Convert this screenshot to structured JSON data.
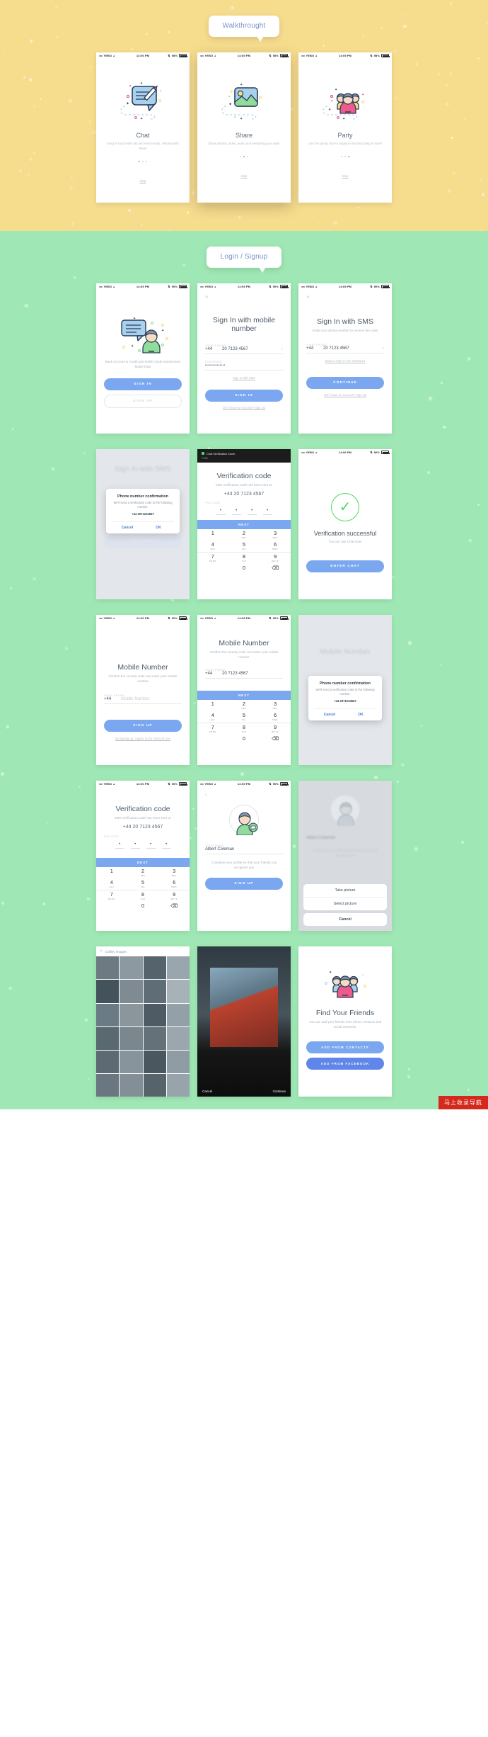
{
  "sections": {
    "walkthrough": {
      "pill_label": "Walkthrought",
      "bg": "#f6dc8d",
      "cards": [
        {
          "title": "Chat",
          "desc": "Keep in touch with old and new friends, chitchat with them!",
          "skip": "Skip",
          "icon": "chat-bubble-pencil-icon"
        },
        {
          "title": "Share",
          "desc": "Share photos, video, audio and everything you want",
          "skip": "Skip",
          "icon": "photo-landscape-icon"
        },
        {
          "title": "Party",
          "desc": "Use the gorup chat to organize the best party in town!",
          "skip": "Skip",
          "icon": "people-group-icon"
        }
      ]
    },
    "login": {
      "pill_label": "Login / Signup",
      "bg": "#9fe8b5"
    }
  },
  "status_bar": {
    "carrier": "YEBO",
    "dots": "•••••",
    "time": "14:05 PM",
    "time_alt": "14:06 PM",
    "battery": "98%",
    "battery_alt": "90%"
  },
  "screens": {
    "welcome": {
      "caption": "Bank Account & Credit and Debit Cards transactions Made Easy",
      "sign_in": "SIGN IN",
      "sign_up": "SIGN UP"
    },
    "sign_in_mobile": {
      "close": "×",
      "title": "Sign In with mobile number",
      "phone_label": "YOUR PHONE",
      "country_code": "+44",
      "phone_value": "20 7123 4567",
      "clear": "×",
      "password_label": "PASSWORD",
      "password_value": "••••••••••••••",
      "sms_link": "Sign In with SMS",
      "button": "SIGN IN",
      "footer": "Don't have an account? Sign Up"
    },
    "sign_in_sms": {
      "close": "×",
      "title": "Sign In with SMS",
      "subtitle": "Enter your phone number to receive the code",
      "phone_label": "YOUR PHONE",
      "country_code": "+44",
      "phone_value": "20 7123 4567",
      "clear": "×",
      "back_link": "Back to Sign In with Password",
      "button": "CONTINUE",
      "footer": "Don't have an account? Sign Up"
    },
    "sms_confirm": {
      "title": "Sign In with SMS",
      "modal_title": "Phone number confirmation",
      "modal_text": "We'll send a verification code to the following number:",
      "modal_number": "+44 2071234567",
      "cancel": "Cancel",
      "ok": "OK",
      "button": "CONTINUE"
    },
    "verification_code": {
      "chat_title": "Chat Verification Code:",
      "chat_code": "7162",
      "title": "Verification code",
      "subtitle": "SMS verification code has been sent to:",
      "number": "+44 20 7123 4567",
      "pin_label": "PIN CODE",
      "next": "NEXT"
    },
    "verification_success": {
      "icon": "check-circle-icon",
      "title": "Verification successful",
      "subtitle": "You can use Chat now!",
      "button": "ENTER CHAT"
    },
    "mobile_number_signup": {
      "title": "Mobile Number",
      "subtitle": "Confirm the country code and enter your mobile number",
      "phone_label": "YOUR PHONE",
      "country_code": "+44",
      "placeholder": "Mobile Number",
      "button": "SIGN UP",
      "footer": "By signing up, I agree to the Terms of Use"
    },
    "mobile_number_filled": {
      "title": "Mobile Number",
      "subtitle": "Confirm the country code and enter your mobile number",
      "phone_label": "YOUR PHONE",
      "country_code": "+44",
      "phone_value": "20 7123 4567",
      "next": "NEXT"
    },
    "mobile_number_modal": {
      "title": "Mobile Number",
      "modal_title": "Phone number confirmation",
      "modal_text": "We'll send a verification code to the following number:",
      "modal_number": "+44 2071234567",
      "cancel": "Cancel",
      "ok": "OK",
      "button": "SIGN UP"
    },
    "verification_keypad": {
      "title": "Verification code",
      "subtitle": "SMS verification code has been sent to:",
      "number": "+44 20 7123 4567",
      "pin_label": "PIN CODE",
      "next": "NEXT"
    },
    "profile_name": {
      "back": "‹",
      "name_label": "YOUR NAME",
      "name_value": "Albert Coleman",
      "hint": "Complete your profile so that your friends can recognize you",
      "button": "SIGN UP",
      "avatar": "avatar-icon"
    },
    "profile_photo_sheet": {
      "name_value": "Albert Coleman",
      "hint": "Complete your profile so that your friends can recognize you",
      "take_picture": "Take picture",
      "select_picture": "Select picture",
      "cancel": "Cancel"
    },
    "gallery": {
      "close": "×",
      "title": "Gallley images"
    },
    "photo_preview": {
      "cancel": "Cancel",
      "continue": "Continue"
    },
    "find_friends": {
      "title": "Find Your Friends",
      "subtitle": "You can add your friends from phone contacts and social networks.",
      "btn_contacts": "ADD FROM CONTACTS",
      "btn_facebook": "ADD FROM FACEBOOK",
      "icon": "people-group-icon"
    }
  },
  "keypad": {
    "keys": [
      {
        "n": "1",
        "l": ""
      },
      {
        "n": "2",
        "l": "ABC"
      },
      {
        "n": "3",
        "l": "DEF"
      },
      {
        "n": "4",
        "l": "GHI"
      },
      {
        "n": "5",
        "l": "JKL"
      },
      {
        "n": "6",
        "l": "MNO"
      },
      {
        "n": "7",
        "l": "PQRS"
      },
      {
        "n": "8",
        "l": "TUV"
      },
      {
        "n": "9",
        "l": "WXYZ"
      },
      {
        "n": "",
        "l": ""
      },
      {
        "n": "0",
        "l": ""
      },
      {
        "n": "⌫",
        "l": ""
      }
    ]
  },
  "watermark": "马上收录导航",
  "colors": {
    "yellow_bg": "#f6dc8d",
    "green_bg": "#9fe8b5",
    "primary_blue": "#7aa7f0",
    "deep_blue": "#5f86e8",
    "success_green": "#4cd964",
    "pill_text": "#7b93c9"
  }
}
